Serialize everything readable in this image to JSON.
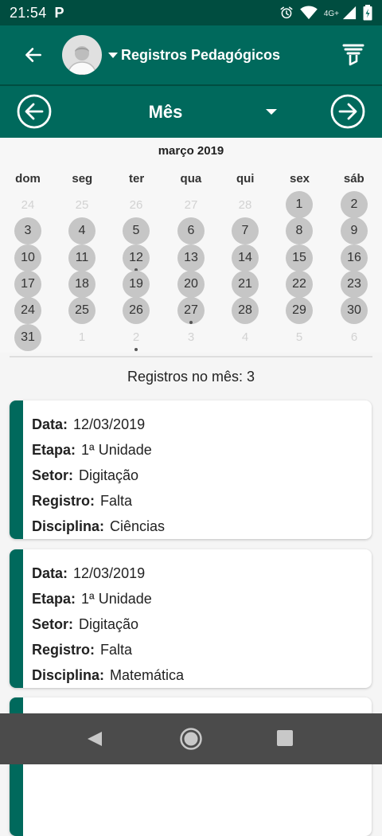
{
  "status": {
    "time": "21:54",
    "p": "P",
    "network": "4G+"
  },
  "appbar": {
    "title": "Registros Pedagógicos"
  },
  "nav": {
    "mode": "Mês"
  },
  "calendar": {
    "month_label": "março 2019",
    "weekdays": [
      "dom",
      "seg",
      "ter",
      "qua",
      "qui",
      "sex",
      "sáb"
    ],
    "days": [
      {
        "n": "24",
        "other": true
      },
      {
        "n": "25",
        "other": true
      },
      {
        "n": "26",
        "other": true
      },
      {
        "n": "27",
        "other": true
      },
      {
        "n": "28",
        "other": true
      },
      {
        "n": "1"
      },
      {
        "n": "2"
      },
      {
        "n": "3"
      },
      {
        "n": "4"
      },
      {
        "n": "5"
      },
      {
        "n": "6"
      },
      {
        "n": "7"
      },
      {
        "n": "8"
      },
      {
        "n": "9"
      },
      {
        "n": "10"
      },
      {
        "n": "11"
      },
      {
        "n": "12",
        "dot": true
      },
      {
        "n": "13"
      },
      {
        "n": "14"
      },
      {
        "n": "15"
      },
      {
        "n": "16"
      },
      {
        "n": "17"
      },
      {
        "n": "18"
      },
      {
        "n": "19"
      },
      {
        "n": "20"
      },
      {
        "n": "21"
      },
      {
        "n": "22"
      },
      {
        "n": "23"
      },
      {
        "n": "24"
      },
      {
        "n": "25"
      },
      {
        "n": "26"
      },
      {
        "n": "27",
        "dot": true
      },
      {
        "n": "28"
      },
      {
        "n": "29"
      },
      {
        "n": "30"
      },
      {
        "n": "31"
      },
      {
        "n": "1",
        "other": true
      },
      {
        "n": "2",
        "other": true,
        "dot": true
      },
      {
        "n": "3",
        "other": true
      },
      {
        "n": "4",
        "other": true
      },
      {
        "n": "5",
        "other": true
      },
      {
        "n": "6",
        "other": true
      }
    ]
  },
  "summary": {
    "label": "Registros no mês: 3"
  },
  "records": [
    {
      "fields": [
        {
          "k": "Data:",
          "v": "12/03/2019"
        },
        {
          "k": "Etapa:",
          "v": "1ª Unidade"
        },
        {
          "k": "Setor:",
          "v": "Digitação"
        },
        {
          "k": "Registro:",
          "v": "Falta"
        },
        {
          "k": "Disciplina:",
          "v": "Ciências"
        }
      ]
    },
    {
      "fields": [
        {
          "k": "Data:",
          "v": "12/03/2019"
        },
        {
          "k": "Etapa:",
          "v": "1ª Unidade"
        },
        {
          "k": "Setor:",
          "v": "Digitação"
        },
        {
          "k": "Registro:",
          "v": "Falta"
        },
        {
          "k": "Disciplina:",
          "v": "Matemática"
        }
      ]
    },
    {
      "fields": []
    }
  ],
  "colors": {
    "primary": "#00695c",
    "primary_dark": "#004d40",
    "day_fill": "#c6c6c6",
    "soft_nav": "#4b4b4b"
  },
  "icons": [
    "back-arrow-icon",
    "avatar-icon",
    "filter-icon",
    "prev-month-icon",
    "next-month-icon",
    "alarm-icon",
    "wifi-icon",
    "signal-icon",
    "battery-icon",
    "nav-back-icon",
    "nav-home-icon",
    "nav-recents-icon"
  ]
}
